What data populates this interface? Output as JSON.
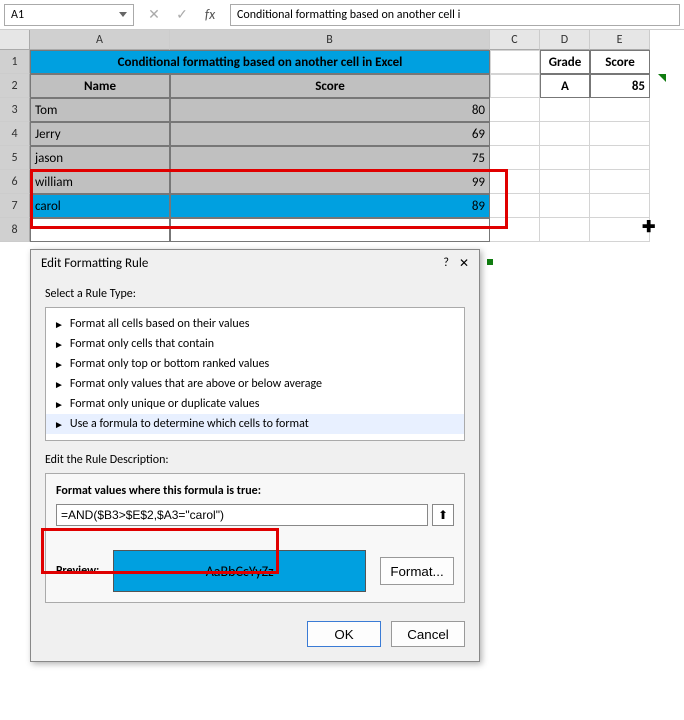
{
  "nameBox": "A1",
  "formulaBar": "Conditional formatting based on another cell i",
  "cols": [
    "A",
    "B",
    "C",
    "D",
    "E"
  ],
  "titleMerged": "Conditional formatting based on another cell in Excel",
  "headerA": "Name",
  "headerB": "Score",
  "data": [
    {
      "name": "Tom",
      "score": "80"
    },
    {
      "name": "Jerry",
      "score": "69"
    },
    {
      "name": "jason",
      "score": "75"
    },
    {
      "name": "william",
      "score": "99"
    },
    {
      "name": "carol",
      "score": "89"
    }
  ],
  "sideGrade": "Grade",
  "sideScore": "Score",
  "sideGradeVal": "A",
  "sideScoreVal": "85",
  "plus": "✚",
  "dialog": {
    "title": "Edit Formatting Rule",
    "help": "?",
    "close": "✕",
    "selectLabel": "Select a Rule Type:",
    "rules": [
      "Format all cells based on their values",
      "Format only cells that contain",
      "Format only top or bottom ranked values",
      "Format only values that are above or below average",
      "Format only unique or duplicate values",
      "Use a formula to determine which cells to format"
    ],
    "editLabel": "Edit the Rule Description:",
    "fvLabel": "Format values where this formula is true:",
    "formula": "=AND($B3>$E$2,$A3=\"carol\")",
    "collapse": "⬆",
    "previewLbl": "Preview:",
    "previewText": "AaBbCcYyZz",
    "formatBtn": "Format...",
    "ok": "OK",
    "cancel": "Cancel"
  }
}
